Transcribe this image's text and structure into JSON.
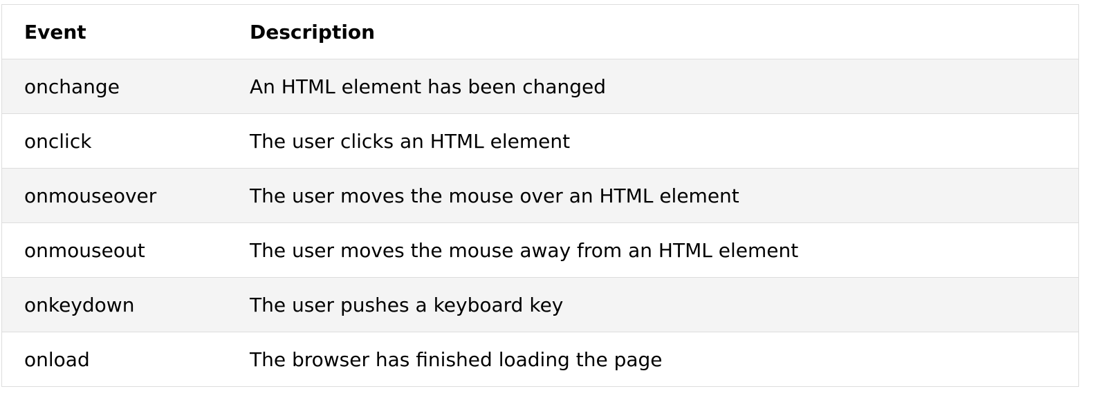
{
  "table": {
    "headers": [
      "Event",
      "Description"
    ],
    "rows": [
      {
        "event": "onchange",
        "description": "An HTML element has been changed"
      },
      {
        "event": "onclick",
        "description": "The user clicks an HTML element"
      },
      {
        "event": "onmouseover",
        "description": "The user moves the mouse over an HTML element"
      },
      {
        "event": "onmouseout",
        "description": "The user moves the mouse away from an HTML element"
      },
      {
        "event": "onkeydown",
        "description": "The user pushes a keyboard key"
      },
      {
        "event": "onload",
        "description": "The browser has finished loading the page"
      }
    ]
  },
  "colors": {
    "border": "#dddddd",
    "row_stripe": "#f4f4f4",
    "row_plain": "#ffffff",
    "text": "#000000"
  }
}
